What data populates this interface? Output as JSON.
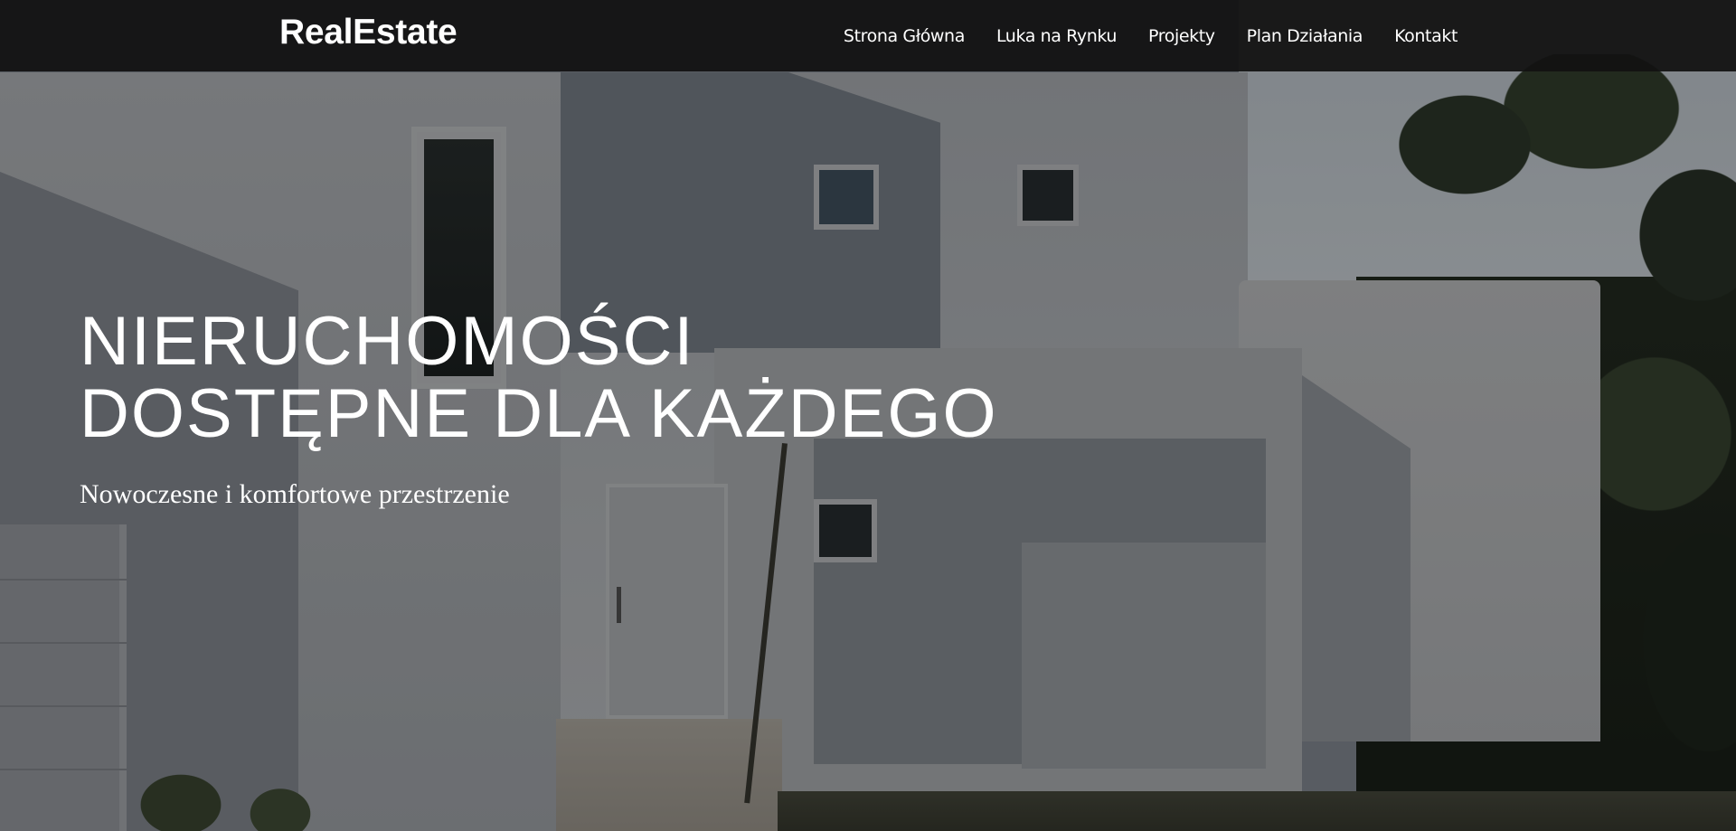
{
  "navbar": {
    "brand": "RealEstate",
    "links": [
      {
        "label": "Strona Główna"
      },
      {
        "label": "Luka na Rynku"
      },
      {
        "label": "Projekty"
      },
      {
        "label": "Plan Działania"
      },
      {
        "label": "Kontakt"
      }
    ]
  },
  "hero": {
    "title_line1": "NIERUCHOMOŚCI",
    "title_line2": "DOSTĘPNE DLA KAŻDEGO",
    "subtitle": "Nowoczesne i komfortowe przestrzenie",
    "background_image": "modern-white-house-photo"
  },
  "colors": {
    "navbar_bg": "#121212",
    "text": "#ffffff"
  }
}
